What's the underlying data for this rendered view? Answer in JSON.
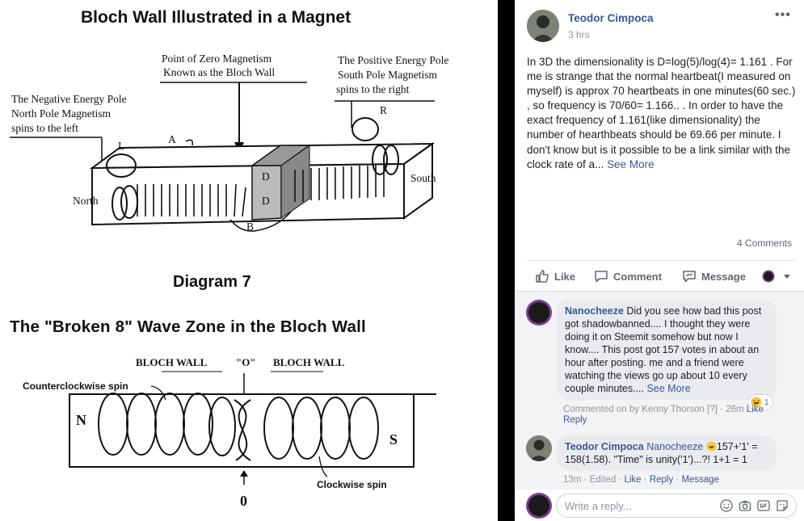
{
  "photo": {
    "diagram1_title": "Bloch Wall Illustrated in a Magnet",
    "label_zero_line1": "Point of Zero Magnetism",
    "label_zero_line2": "Known as the Bloch Wall",
    "label_positive_line1": "The Positive Energy Pole",
    "label_positive_line2": "South Pole Magnetism",
    "label_positive_line3": "spins to the right",
    "label_negative_line1": "The Negative Energy Pole",
    "label_negative_line2": "North Pole Magnetism",
    "label_negative_line3": "spins to the left",
    "label_L": "L",
    "label_R": "R",
    "label_A": "A",
    "label_B": "B",
    "label_D_top": "D",
    "label_D_bottom": "D",
    "label_north": "North",
    "label_south": "South",
    "diagram2_title": "Diagram 7",
    "diagram3_title": "The \"Broken 8\"  Wave Zone in the Bloch Wall",
    "label_bloch_wall_left": "BLOCH WALL",
    "label_zero_quote": "\"O\"",
    "label_bloch_wall_right": "BLOCH WALL",
    "label_counterclockwise": "Counterclockwise spin",
    "label_clockwise": "Clockwise spin",
    "label_N": "N",
    "label_S": "S",
    "label_zero_bottom": "0"
  },
  "post": {
    "author": "Teodor Cimpoca",
    "time": "3 hrs",
    "more_label": "•••",
    "text": "In 3D the dimensionality is D=log(5)/log(4)= 1.161 . For me is strange that the normal heartbeat(I measured on myself) is approx 70 heartbeats in one minutes(60 sec.) , so frequency is 70/60= 1.166.. . In order to have the exact frequency of 1.161(like dimensionality) the number of hearthbeats should be 69.66 per minute. I don't know but is it possible to be a link similar with the clock rate of a...",
    "see_more": "See More",
    "comment_count": "4 Comments"
  },
  "actions": {
    "like": "Like",
    "comment": "Comment",
    "message": "Message"
  },
  "comments": [
    {
      "author": "Nanocheeze",
      "text": " Did you see how bad this post got shadowbanned.... I thought they were doing it on Steemit somehow but now I know.... This post got 157 votes in about an hour after posting. me and a friend were watching the views go up about 10 every couple minutes.... ",
      "see_more": "See More",
      "reaction_count": "1",
      "meta_commented": "Commented on by Kenny Thorson",
      "meta_q": "[?]",
      "meta_time": "26m",
      "meta_like": "Like",
      "reply": "Reply"
    },
    {
      "author": "Teodor Cimpoca",
      "mention": "Nanocheeze",
      "text": "157+'1' = 158(1.58). \"Time\" is unity('1')...?! 1+1 = 1",
      "meta_time": "13m",
      "meta_edited": "Edited",
      "meta_like": "Like",
      "meta_reply": "Reply",
      "meta_message": "Message"
    }
  ],
  "reply_bar": {
    "placeholder": "Write a reply..."
  },
  "colors": {
    "link_blue": "#385898",
    "meta_gray": "#90949c",
    "comment_bg": "#f2f3f5",
    "bubble_bg": "#e9ebee"
  }
}
